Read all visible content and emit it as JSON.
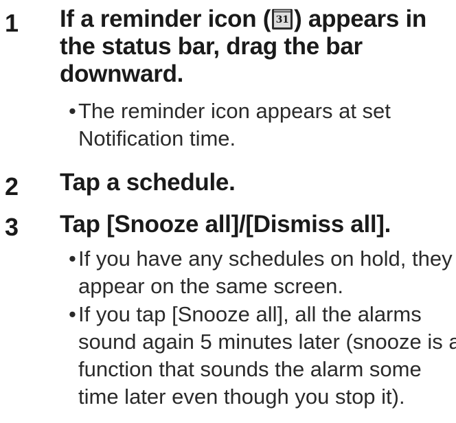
{
  "steps": [
    {
      "number": "1",
      "heading_before_icon": "If a reminder icon (",
      "icon": {
        "name": "calendar-reminder-icon",
        "text": "31"
      },
      "heading_after_icon": ") appears in the status bar, drag the bar downward.",
      "bullets": [
        "The reminder icon appears at set Notification time."
      ]
    },
    {
      "number": "2",
      "heading": "Tap a schedule.",
      "bullets": []
    },
    {
      "number": "3",
      "heading": "Tap [Snooze all]/[Dismiss all].",
      "bullets": [
        "If you have any schedules on hold, they appear on the same screen.",
        "If you tap [Snooze all], all the alarms sound again 5 minutes later (snooze is a function that sounds the alarm some time later even though you stop it)."
      ]
    }
  ],
  "bullet_symbol": "•"
}
